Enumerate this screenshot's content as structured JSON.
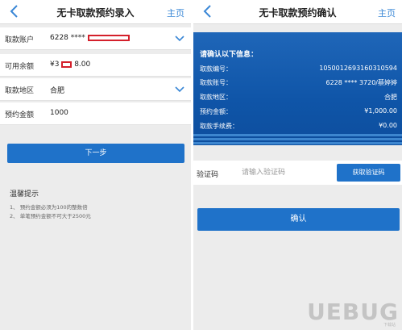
{
  "left": {
    "nav": {
      "back_icon": "chevron-left-icon",
      "title": "无卡取款预约录入",
      "home": "主页"
    },
    "form": {
      "account": {
        "label": "取款账户",
        "value": "6228 ****"
      },
      "balance": {
        "label": "可用余额",
        "prefix": "¥3",
        "suffix": "8.00"
      },
      "region": {
        "label": "取款地区",
        "value": "合肥"
      },
      "amount": {
        "label": "预约金额",
        "value": "1000"
      }
    },
    "next_button": "下一步",
    "tips": {
      "title": "温馨提示",
      "items": [
        "1、 预约金额必须为100的整数倍",
        "2、 单笔预约金额不可大于2500元"
      ]
    }
  },
  "right": {
    "nav": {
      "back_icon": "chevron-left-icon",
      "title": "无卡取款预约确认",
      "home": "主页"
    },
    "info": {
      "heading": "请确认以下信息：",
      "rows": [
        {
          "label": "取款编号：",
          "value": "1050012693160310594"
        },
        {
          "label": "取款账号：",
          "value": "6228 **** 3720/蔡婷婷"
        },
        {
          "label": "取款地区：",
          "value": "合肥"
        },
        {
          "label": "预约金额：",
          "value": "¥1,000.00"
        },
        {
          "label": "取款手续费：",
          "value": "¥0.00"
        }
      ]
    },
    "captcha": {
      "label": "验证码",
      "placeholder": "请输入验证码",
      "button": "获取验证码"
    },
    "confirm_button": "确认"
  },
  "watermark": {
    "text": "UEBUG",
    "sub": "下载站"
  },
  "colors": {
    "primary": "#1f72c9",
    "info_bg": "#0f55a8",
    "link": "#3a87d6",
    "redaction": "#d4202b",
    "background": "#ececec"
  }
}
